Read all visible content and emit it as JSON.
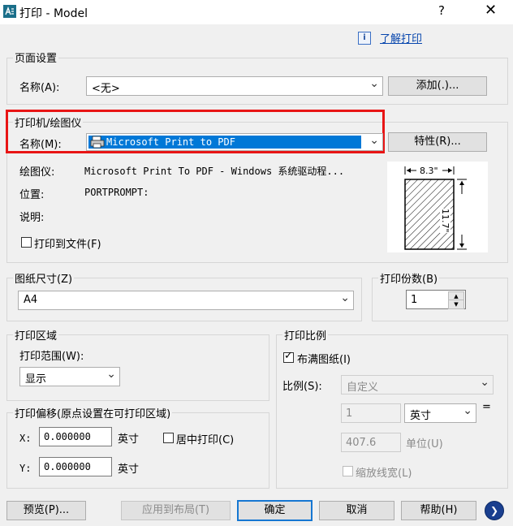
{
  "window": {
    "title": "打印 - Model",
    "help_glyph": "?",
    "close_glyph": "✕"
  },
  "help_link": {
    "icon": "i",
    "label": "了解打印"
  },
  "page_setup": {
    "label": "页面设置",
    "name_label": "名称(A):",
    "name_value": "<无>",
    "add_button": "添加(.)..."
  },
  "printer": {
    "label": "打印机/绘图仪",
    "name_label": "名称(M):",
    "name_value": "Microsoft Print to PDF",
    "properties_button": "特性(R)...",
    "plotter_label": "绘图仪:",
    "plotter_value": "Microsoft Print To PDF - Windows 系统驱动程...",
    "location_label": "位置:",
    "location_value": "PORTPROMPT:",
    "description_label": "说明:",
    "print_to_file_label": "打印到文件(F)",
    "print_to_file_checked": false,
    "preview": {
      "width_label": "8.3\"",
      "height_label": "11.7\""
    }
  },
  "paper_size": {
    "label": "图纸尺寸(Z)",
    "value": "A4"
  },
  "copies": {
    "label": "打印份数(B)",
    "value": "1"
  },
  "plot_area": {
    "label": "打印区域",
    "range_label": "打印范围(W):",
    "range_value": "显示"
  },
  "plot_scale": {
    "label": "打印比例",
    "fit_label": "布满图纸(I)",
    "fit_checked": true,
    "scale_label": "比例(S):",
    "scale_value": "自定义",
    "value1": "1",
    "unit_value": "英寸",
    "equals": "=",
    "value2": "407.6",
    "unit2_label": "单位(U)",
    "lineweights_label": "缩放线宽(L)"
  },
  "plot_offset": {
    "label": "打印偏移(原点设置在可打印区域)",
    "x_label": "X:",
    "x_value": "0.000000",
    "x_unit": "英寸",
    "center_label": "居中打印(C)",
    "y_label": "Y:",
    "y_value": "0.000000",
    "y_unit": "英寸"
  },
  "footer": {
    "preview_button": "预览(P)...",
    "apply_button": "应用到布局(T)",
    "ok_button": "确定",
    "cancel_button": "取消",
    "help_button": "帮助(H)",
    "more_glyph": "❯"
  },
  "colors": {
    "highlight_box": "#e81515",
    "selection": "#0078d7",
    "link": "#0645ad"
  }
}
